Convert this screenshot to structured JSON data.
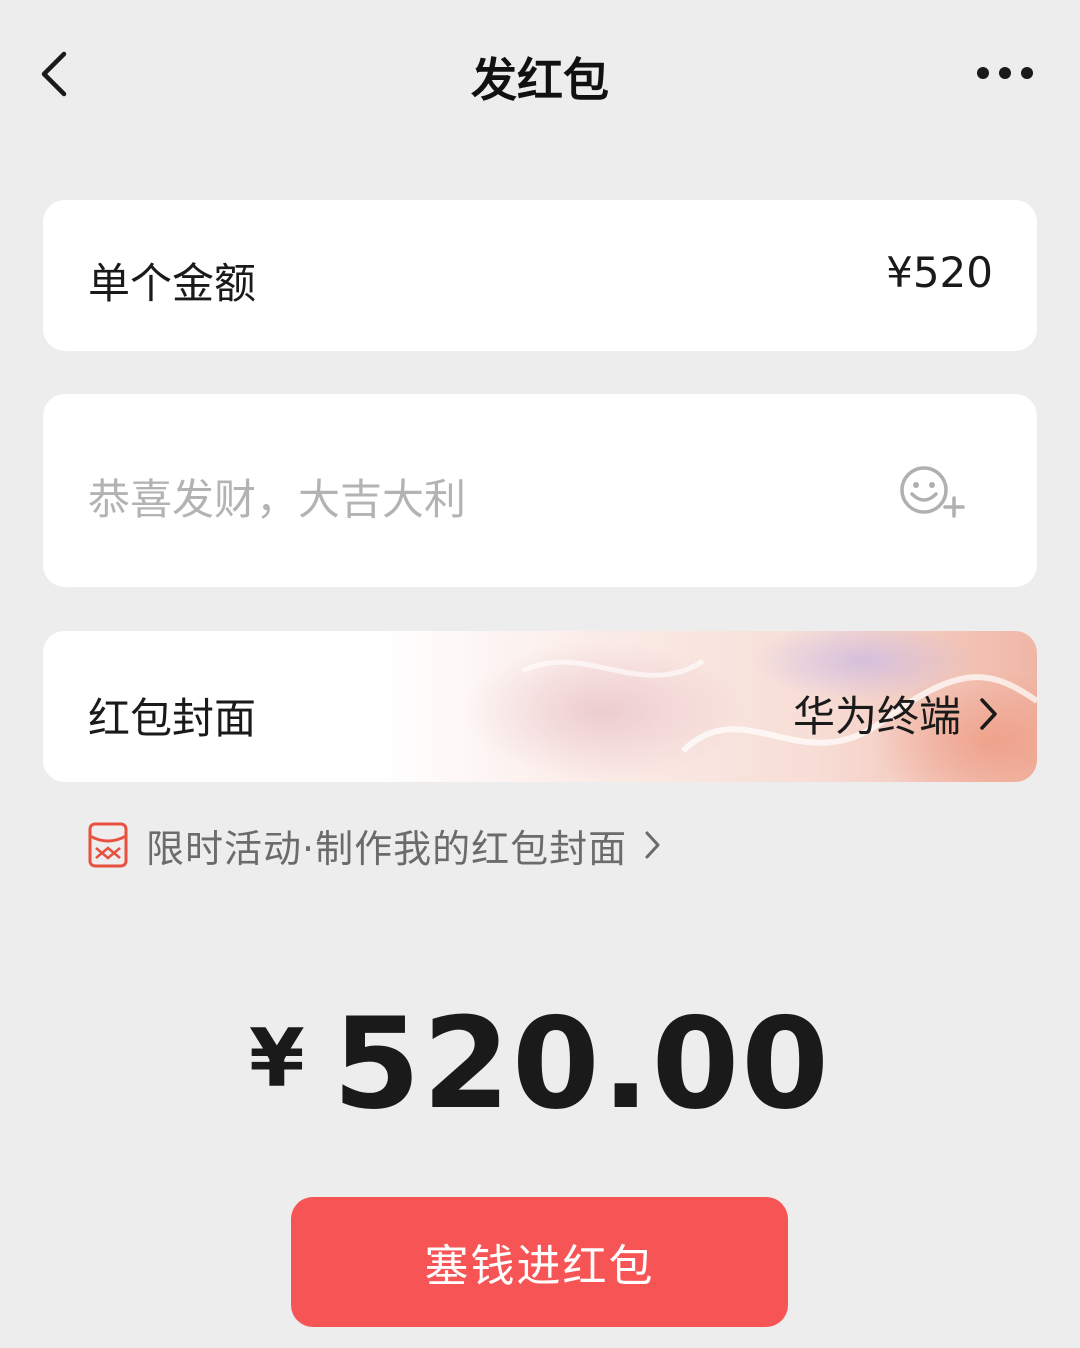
{
  "header": {
    "title": "发红包",
    "back_icon": "chevron-left-icon",
    "more_icon": "more-dots-icon"
  },
  "amount": {
    "label": "单个金额",
    "value": "¥520"
  },
  "message": {
    "placeholder": "恭喜发财，大吉大利",
    "emoji_icon": "emoji-add-icon"
  },
  "cover": {
    "label": "红包封面",
    "selected": "华为终端"
  },
  "promo": {
    "text": "限时活动·制作我的红包封面",
    "icon": "red-envelope-icon"
  },
  "total": {
    "currency": "¥",
    "value": "520.00"
  },
  "submit": {
    "label": "塞钱进红包"
  },
  "colors": {
    "background": "#ededed",
    "card": "#ffffff",
    "accent": "#f75555",
    "placeholder": "#b3b3b3",
    "secondary_text": "#6b6b6b"
  }
}
